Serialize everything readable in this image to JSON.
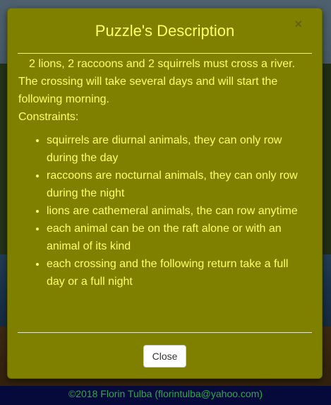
{
  "modal": {
    "title": "Puzzle's Description",
    "close_symbol": "×",
    "intro": "2 lions, 2 raccoons and 2 squirrels must cross a river. The crossing will take several days and will start the following morning.",
    "constraints_label": "Constraints:",
    "constraints": [
      "squirrels are diurnal animals, they can only row during the day",
      "raccoons are nocturnal animals, they can only row during the night",
      "lions are cathemeral animals, the can row anytime",
      "each animal can be on the raft alone or with an animal of its kind",
      "each crossing and the following return take a full day or a full night"
    ],
    "close_button_label": "Close"
  },
  "footer": {
    "text": "©2018 Florin Tulba (florintulba@yahoo.com)"
  },
  "colors": {
    "modal_background": "#808000",
    "modal_text": "#ffff66",
    "footer_background": "#050a3a",
    "footer_text": "#2ea84a"
  }
}
